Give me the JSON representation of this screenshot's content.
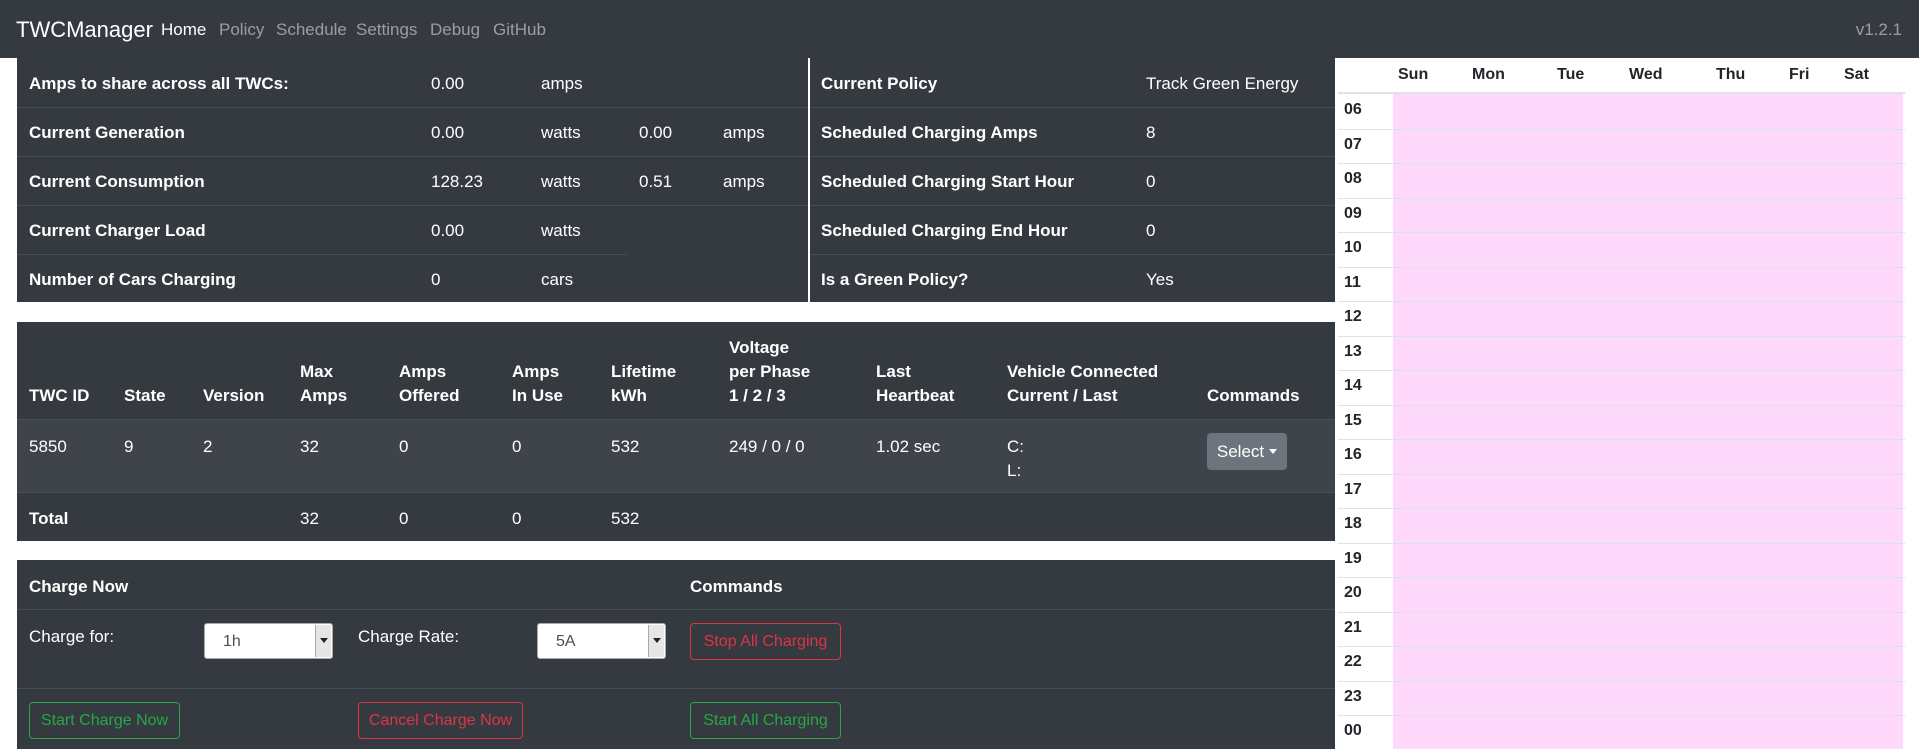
{
  "navbar": {
    "brand": "TWCManager",
    "links": [
      "Home",
      "Policy",
      "Schedule",
      "Settings",
      "Debug",
      "GitHub"
    ],
    "version": "v1.2.1"
  },
  "summary": {
    "rows": [
      {
        "label": "Amps to share across all TWCs:",
        "value": "0.00",
        "unit": "amps"
      },
      {
        "label": "Current Generation",
        "value": "0.00",
        "unit": "watts",
        "value2": "0.00",
        "unit2": "amps"
      },
      {
        "label": "Current Consumption",
        "value": "128.23",
        "unit": "watts",
        "value2": "0.51",
        "unit2": "amps"
      },
      {
        "label": "Current Charger Load",
        "value": "0.00",
        "unit": "watts"
      },
      {
        "label": "Number of Cars Charging",
        "value": "0",
        "unit": "cars"
      }
    ]
  },
  "policy": {
    "rows": [
      {
        "label": "Current Policy",
        "value": "Track Green Energy"
      },
      {
        "label": "Scheduled Charging Amps",
        "value": "8"
      },
      {
        "label": "Scheduled Charging Start Hour",
        "value": "0"
      },
      {
        "label": "Scheduled Charging End Hour",
        "value": "0"
      },
      {
        "label": "Is a Green Policy?",
        "value": "Yes"
      }
    ]
  },
  "twc_table": {
    "headers": {
      "twc_id": "TWC ID",
      "state": "State",
      "version": "Version",
      "max_amps_1": "Max",
      "max_amps_2": "Amps",
      "amps_offered_1": "Amps",
      "amps_offered_2": "Offered",
      "amps_in_use_1": "Amps",
      "amps_in_use_2": "In Use",
      "lifetime_1": "Lifetime",
      "lifetime_2": "kWh",
      "voltage_1": "Voltage",
      "voltage_2": "per Phase",
      "voltage_3": "1 / 2 / 3",
      "heartbeat_1": "Last",
      "heartbeat_2": "Heartbeat",
      "vehicle_1": "Vehicle Connected",
      "vehicle_2": "Current / Last",
      "commands": "Commands"
    },
    "row": {
      "twc_id": "5850",
      "state": "9",
      "version": "2",
      "max_amps": "32",
      "amps_offered": "0",
      "amps_in_use": "0",
      "lifetime_kwh": "532",
      "voltage": "249 / 0 / 0",
      "last_heartbeat": "1.02 sec",
      "vehicle_current": "C:",
      "vehicle_last": "L:",
      "command_button": "Select"
    },
    "total": {
      "label": "Total",
      "max_amps": "32",
      "amps_offered": "0",
      "amps_in_use": "0",
      "lifetime_kwh": "532"
    }
  },
  "charge_now": {
    "title": "Charge Now",
    "commands_title": "Commands",
    "charge_for_label": "Charge for:",
    "charge_for_value": "1h",
    "charge_rate_label": "Charge Rate:",
    "charge_rate_value": "5A",
    "stop_all": "Stop All Charging",
    "start_charge_now": "Start Charge Now",
    "cancel_charge_now": "Cancel Charge Now",
    "start_all": "Start All Charging"
  },
  "schedule": {
    "days": [
      "Sun",
      "Mon",
      "Tue",
      "Wed",
      "Thu",
      "Fri",
      "Sat"
    ],
    "hours": [
      "06",
      "07",
      "08",
      "09",
      "10",
      "11",
      "12",
      "13",
      "14",
      "15",
      "16",
      "17",
      "18",
      "19",
      "20",
      "21",
      "22",
      "23",
      "00"
    ],
    "scheduled_color": "#ffd9fc"
  }
}
